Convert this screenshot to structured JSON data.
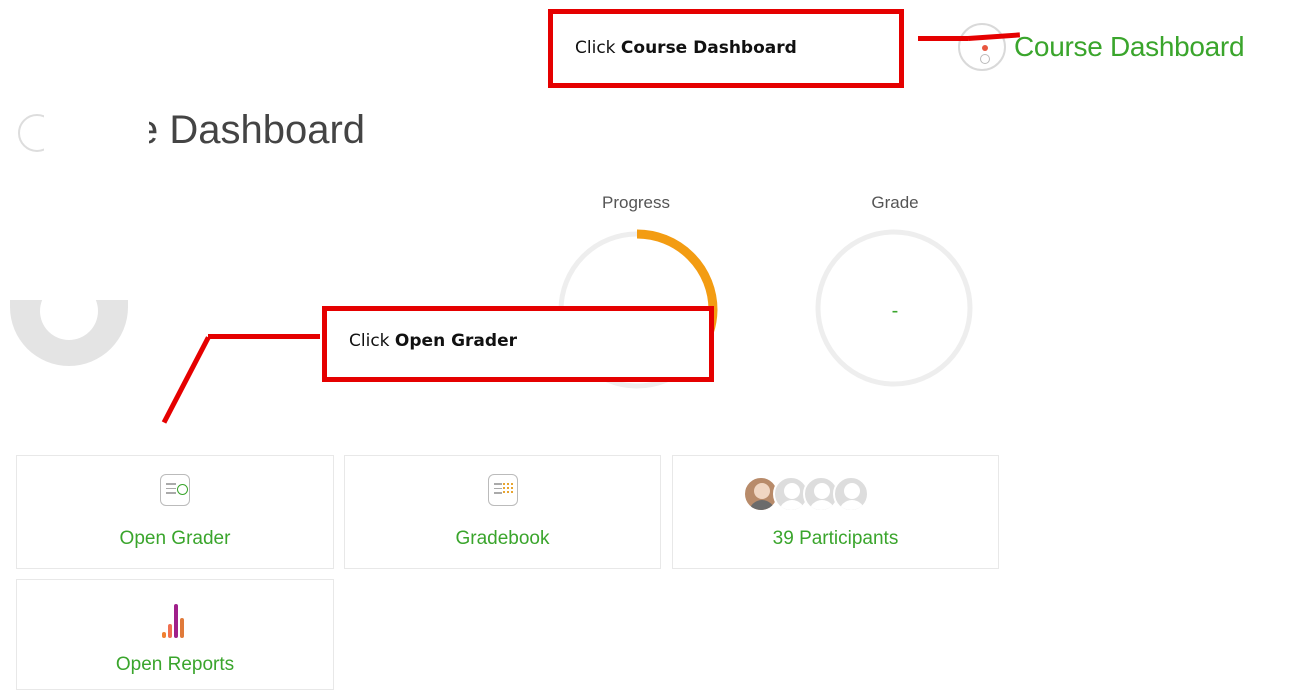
{
  "course_dashboard_link": {
    "label": "Course Dashboard"
  },
  "callouts": [
    {
      "prefix": "Click ",
      "bold": "Course Dashboard"
    },
    {
      "prefix": "Click ",
      "bold": "Open Grader"
    }
  ],
  "page_title": "e Dashboard",
  "metrics": {
    "progress": {
      "label": "Progress",
      "value_text": "33"
    },
    "grade": {
      "label": "Grade",
      "value_text": "-"
    }
  },
  "tiles": [
    {
      "label": "Open Grader",
      "icon": "grader-icon"
    },
    {
      "label": "Gradebook",
      "icon": "gradebook-icon"
    },
    {
      "label": "39 Participants",
      "icon": "participants-avatars"
    },
    {
      "label": "Open Reports",
      "icon": "reports-icon"
    }
  ],
  "colors": {
    "accent_green": "#3aa52c",
    "callout_red": "#e50000",
    "progress_orange": "#f39c12"
  }
}
